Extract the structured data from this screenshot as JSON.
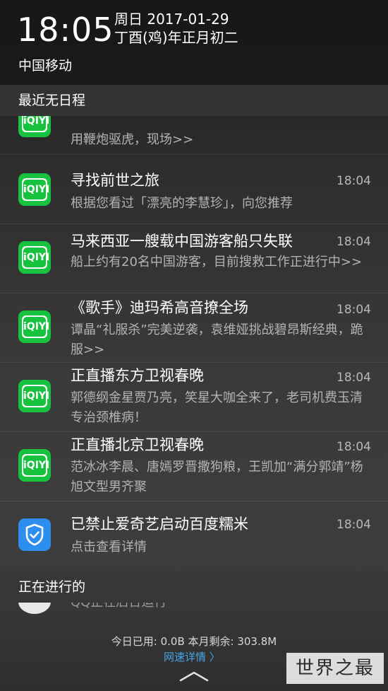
{
  "status": {
    "time": "18:05",
    "date_line": "周日 2017-01-29",
    "lunar_line": "丁酉(鸡)年正月初二",
    "carrier": "中国移动"
  },
  "schedule_header": "最近无日程",
  "notifications": [
    {
      "app": "iqiyi",
      "title": "",
      "time": "",
      "body": "用鞭炮驱虎，现场>>"
    },
    {
      "app": "iqiyi",
      "title": "寻找前世之旅",
      "time": "18:04",
      "body": "根据您看过「漂亮的李慧珍」，向您推荐"
    },
    {
      "app": "iqiyi",
      "title": "马来西亚一艘载中国游客船只失联",
      "time": "18:04",
      "body": "船上约有20名中国游客，目前搜救工作正进行中>>"
    },
    {
      "app": "iqiyi",
      "title": "《歌手》迪玛希高音撩全场",
      "time": "18:04",
      "body": "谭晶“礼服杀”完美逆袭，袁维娅挑战碧昂斯经典，跪服>>"
    },
    {
      "app": "iqiyi",
      "title": "正直播东方卫视春晚",
      "time": "18:04",
      "body": "郭德纲金星贾乃亮，笑星大咖全来了，老司机费玉清专治颈椎病！"
    },
    {
      "app": "iqiyi",
      "title": "正直播北京卫视春晚",
      "time": "18:04",
      "body": "范冰冰李晨、唐嫣罗晋撒狗粮，王凯加“满分郭靖”杨旭文型男齐聚"
    },
    {
      "app": "security",
      "title": "已禁止爱奇艺启动百度糯米",
      "time": "18:04",
      "body": "点击查看详情"
    }
  ],
  "icons": {
    "iqiyi": "iqiyi-app-icon",
    "security": "shield-check-icon",
    "qq": "qq-app-icon",
    "handle": "chevron-up-icon"
  },
  "iqiyi_badge_text": "iQIYI",
  "ongoing_header": "正在进行的",
  "ongoing_item": "QQ正在后台运行",
  "data_usage": "今日已用: 0.0B   本月剩余: 303.8M",
  "network_details": "网速详情 〉",
  "watermark": "世界之最",
  "colors": {
    "iqiyi_green": "#17c23e",
    "security_blue": "#2d8ef0",
    "link_blue": "#45a6e8"
  }
}
